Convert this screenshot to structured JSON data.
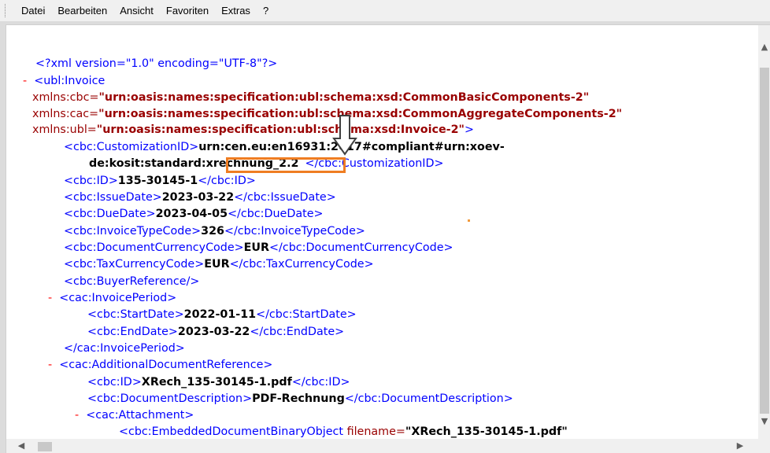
{
  "menubar": {
    "items": [
      "Datei",
      "Bearbeiten",
      "Ansicht",
      "Favoriten",
      "Extras",
      "?"
    ]
  },
  "xml": {
    "declaration": "<?xml version=\"1.0\" encoding=\"UTF-8\"?>",
    "minus": "-",
    "invoice_open": "<ubl:Invoice",
    "ns_cbc_attr": "xmlns:cbc=",
    "ns_cbc_val": "\"urn:oasis:names:specification:ubl:schema:xsd:CommonBasicComponents-2\"",
    "ns_cac_attr": "xmlns:cac=",
    "ns_cac_val": "\"urn:oasis:names:specification:ubl:schema:xsd:CommonAggregateComponents-2\"",
    "ns_ubl_attr": "xmlns:ubl=",
    "ns_ubl_val": "\"urn:oasis:names:specification:ubl:schema:xsd:Invoice-2\"",
    "ns_ubl_close": ">",
    "customization_open": "<cbc:CustomizationID>",
    "customization_val1": "urn:cen.eu:en16931:2017#compliant#urn:xoev-",
    "customization_val2": "de:kosit:standard:",
    "customization_version": "xrechnung_2.2",
    "customization_close": "</cbc:CustomizationID>",
    "id_open": "<cbc:ID>",
    "id_val": "135-30145-1",
    "id_close": "</cbc:ID>",
    "issue_open": "<cbc:IssueDate>",
    "issue_val": "2023-03-22",
    "issue_close": "</cbc:IssueDate>",
    "due_open": "<cbc:DueDate>",
    "due_val": "2023-04-05",
    "due_close": "</cbc:DueDate>",
    "type_open": "<cbc:InvoiceTypeCode>",
    "type_val": "326",
    "type_close": "</cbc:InvoiceTypeCode>",
    "doccur_open": "<cbc:DocumentCurrencyCode>",
    "doccur_val": "EUR",
    "doccur_close": "</cbc:DocumentCurrencyCode>",
    "taxcur_open": "<cbc:TaxCurrencyCode>",
    "taxcur_val": "EUR",
    "taxcur_close": "</cbc:TaxCurrencyCode>",
    "buyer_ref": "<cbc:BuyerReference/>",
    "period_open": "<cac:InvoicePeriod>",
    "start_open": "<cbc:StartDate>",
    "start_val": "2022-01-11",
    "start_close": "</cbc:StartDate>",
    "end_open": "<cbc:EndDate>",
    "end_val": "2023-03-22",
    "end_close": "</cbc:EndDate>",
    "period_close": "</cac:InvoicePeriod>",
    "addref_open": "<cac:AdditionalDocumentReference>",
    "addref_id_open": "<cbc:ID>",
    "addref_id_val": "XRech_135-30145-1.pdf",
    "addref_id_close": "</cbc:ID>",
    "desc_open": "<cbc:DocumentDescription>",
    "desc_val": "PDF-Rechnung",
    "desc_close": "</cbc:DocumentDescription>",
    "attach_open": "<cac:Attachment>",
    "embed_open": "<cbc:EmbeddedDocumentBinaryObject ",
    "embed_attr": "filename=",
    "embed_val": "\"XRech_135-30145-1.pdf\""
  },
  "icons": {
    "arrow": "down-arrow-icon",
    "scroll_up": "chevron-up-icon",
    "scroll_down": "chevron-down-icon",
    "scroll_left": "chevron-left-icon",
    "scroll_right": "chevron-right-icon"
  },
  "colors": {
    "tag": "#0000ff",
    "attribute": "#990000",
    "minus": "#ff0000",
    "value": "#000000",
    "highlight_border": "#ef7d22"
  }
}
